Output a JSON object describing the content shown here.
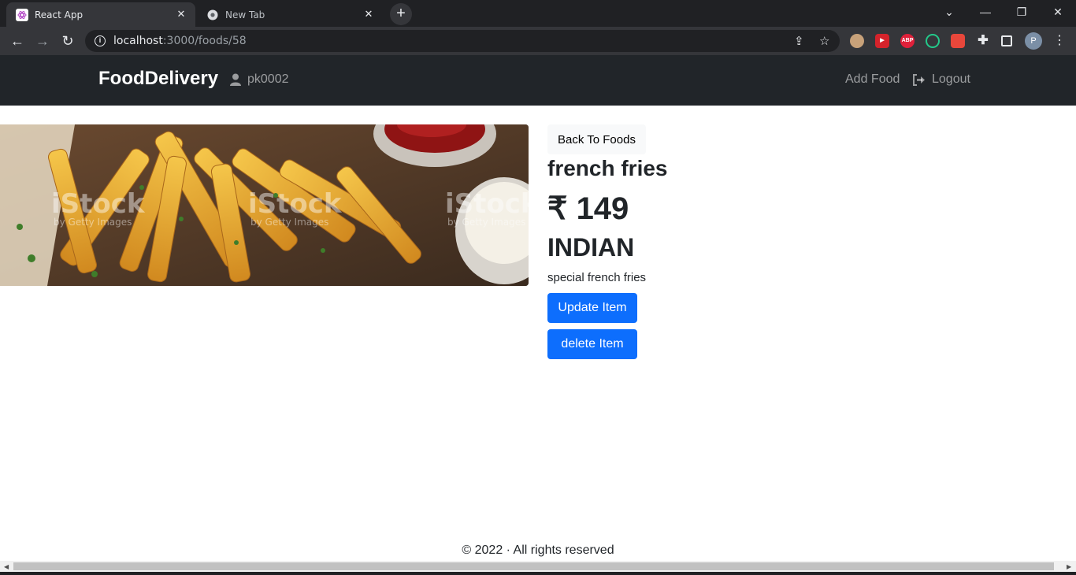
{
  "browser": {
    "tabs": [
      {
        "title": "React App",
        "active": true,
        "icon": "react-icon"
      },
      {
        "title": "New Tab",
        "active": false,
        "icon": "chrome-icon"
      }
    ],
    "url_host": "localhost",
    "url_path": ":3000/foods/58",
    "profile_initial": "P",
    "ext_abp": "ABP"
  },
  "navbar": {
    "brand": "FoodDelivery",
    "username": "pk0002",
    "add_food": "Add Food",
    "logout": "Logout"
  },
  "food": {
    "back_label": "Back To Foods",
    "name": "french fries",
    "price": "₹ 149",
    "cuisine": "INDIAN",
    "description": "special french fries",
    "update_label": "Update Item",
    "delete_label": "delete Item",
    "image_watermark": "iStock",
    "image_watermark_sub": "by Getty Images"
  },
  "footer": {
    "text": "© 2022 · All rights reserved"
  }
}
